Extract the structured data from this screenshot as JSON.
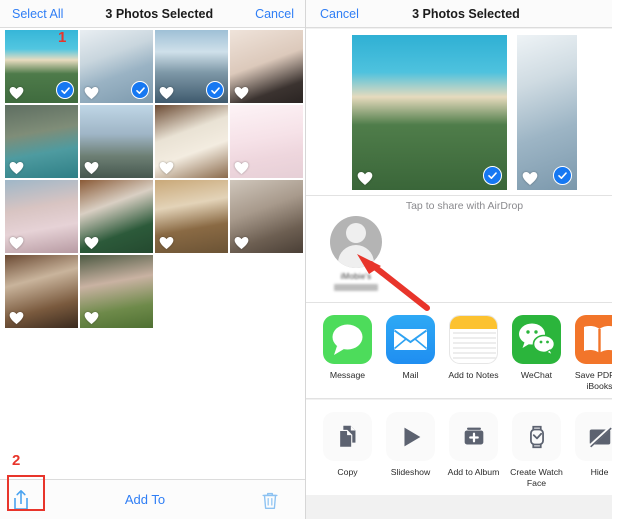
{
  "photos_pane": {
    "nav": {
      "select_all_label": "Select All",
      "title": "3 Photos Selected",
      "cancel_label": "Cancel"
    },
    "grid": {
      "rows": [
        [
          {
            "name": "photo-woman-beach-hair",
            "selected": true,
            "favorite": true
          },
          {
            "name": "photo-snow-village",
            "selected": true,
            "favorite": true
          },
          {
            "name": "photo-lake-town",
            "selected": true,
            "favorite": true
          },
          {
            "name": "photo-kitten-bowl",
            "selected": false,
            "favorite": true
          }
        ],
        [
          {
            "name": "photo-lake-shore",
            "selected": false,
            "favorite": true
          },
          {
            "name": "photo-mountain-range",
            "selected": false,
            "favorite": true
          },
          {
            "name": "photo-white-dog",
            "selected": false,
            "favorite": true
          },
          {
            "name": "photo-anime-girl",
            "selected": false,
            "favorite": true
          }
        ],
        [
          {
            "name": "photo-woman-flowers",
            "selected": false,
            "favorite": true
          },
          {
            "name": "photo-husky-yawn",
            "selected": false,
            "favorite": true
          },
          {
            "name": "photo-corgi-running",
            "selected": false,
            "favorite": true
          },
          {
            "name": "photo-husky-closeup",
            "selected": false,
            "favorite": true
          }
        ],
        [
          {
            "name": "photo-husky-sitting",
            "selected": false,
            "favorite": true
          },
          {
            "name": "photo-child-grass",
            "selected": false,
            "favorite": true
          }
        ]
      ]
    },
    "toolbar": {
      "share_icon": "share-icon",
      "add_to_label": "Add To",
      "trash_icon": "trash-icon"
    }
  },
  "share_sheet": {
    "nav": {
      "cancel_label": "Cancel",
      "title": "3 Photos Selected"
    },
    "preview": [
      {
        "name": "preview-woman-beach-hair",
        "selected": true,
        "favorite": true
      },
      {
        "name": "preview-snow-village",
        "selected": true,
        "favorite": true
      }
    ],
    "airdrop": {
      "hint": "Tap to share with AirDrop",
      "contact_name": "iMobie's",
      "avatar_icon": "person-avatar-icon"
    },
    "apps": [
      {
        "label": "Message",
        "icon": "messages-icon"
      },
      {
        "label": "Mail",
        "icon": "mail-icon"
      },
      {
        "label": "Add to Notes",
        "icon": "notes-icon"
      },
      {
        "label": "WeChat",
        "icon": "wechat-icon"
      },
      {
        "label": "Save PDF to iBooks",
        "icon": "ibooks-icon"
      }
    ],
    "actions": [
      {
        "label": "Copy",
        "icon": "copy-icon"
      },
      {
        "label": "Slideshow",
        "icon": "play-icon"
      },
      {
        "label": "Add to Album",
        "icon": "add-to-album-icon"
      },
      {
        "label": "Create Watch Face",
        "icon": "watch-icon"
      },
      {
        "label": "Hide",
        "icon": "hide-icon"
      }
    ]
  },
  "annotations": {
    "step_1": "1",
    "step_2": "2",
    "accent_color": "#e8352b",
    "arrow_icon": "red-arrow-icon"
  }
}
